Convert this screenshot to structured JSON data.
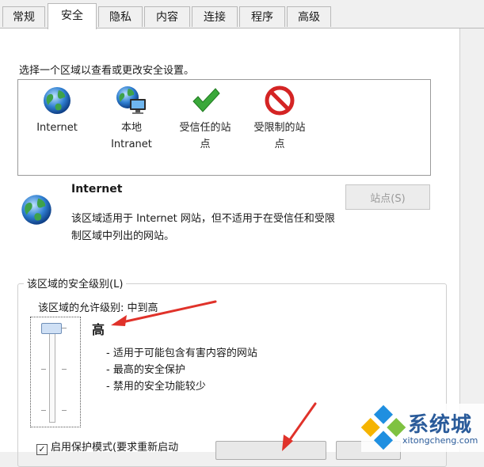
{
  "tabs": [
    "常规",
    "安全",
    "隐私",
    "内容",
    "连接",
    "程序",
    "高级"
  ],
  "active_tab": "安全",
  "instruction": "选择一个区域以查看或更改安全设置。",
  "zones": [
    {
      "label_line1": "Internet",
      "label_line2": "",
      "icon": "globe-icon"
    },
    {
      "label_line1": "本地",
      "label_line2": "Intranet",
      "icon": "intranet-icon"
    },
    {
      "label_line1": "受信任的站",
      "label_line2": "点",
      "icon": "checkmark-icon"
    },
    {
      "label_line1": "受限制的站",
      "label_line2": "点",
      "icon": "restricted-icon"
    }
  ],
  "selected_zone": {
    "title": "Internet",
    "description": "该区域适用于 Internet 网站，但不适用于在受信任和受限制区域中列出的网站。",
    "sites_button": "站点(S)"
  },
  "security_level": {
    "group_title": "该区域的安全级别(L)",
    "allowed": "该区域的允许级别: 中到高",
    "level_name": "高",
    "slider_level_fraction": 1.0,
    "bullets": [
      "- 适用于可能包含有害内容的网站",
      "- 最高的安全保护",
      "- 禁用的安全功能较少"
    ]
  },
  "protected_mode": {
    "label": "启用保护模式(要求重新启动",
    "checked": true
  },
  "watermark": {
    "name": "系统城",
    "url": "xitongcheng.com"
  },
  "colors": {
    "arrow": "#e0322a",
    "watermark": "#2a5b9a"
  }
}
